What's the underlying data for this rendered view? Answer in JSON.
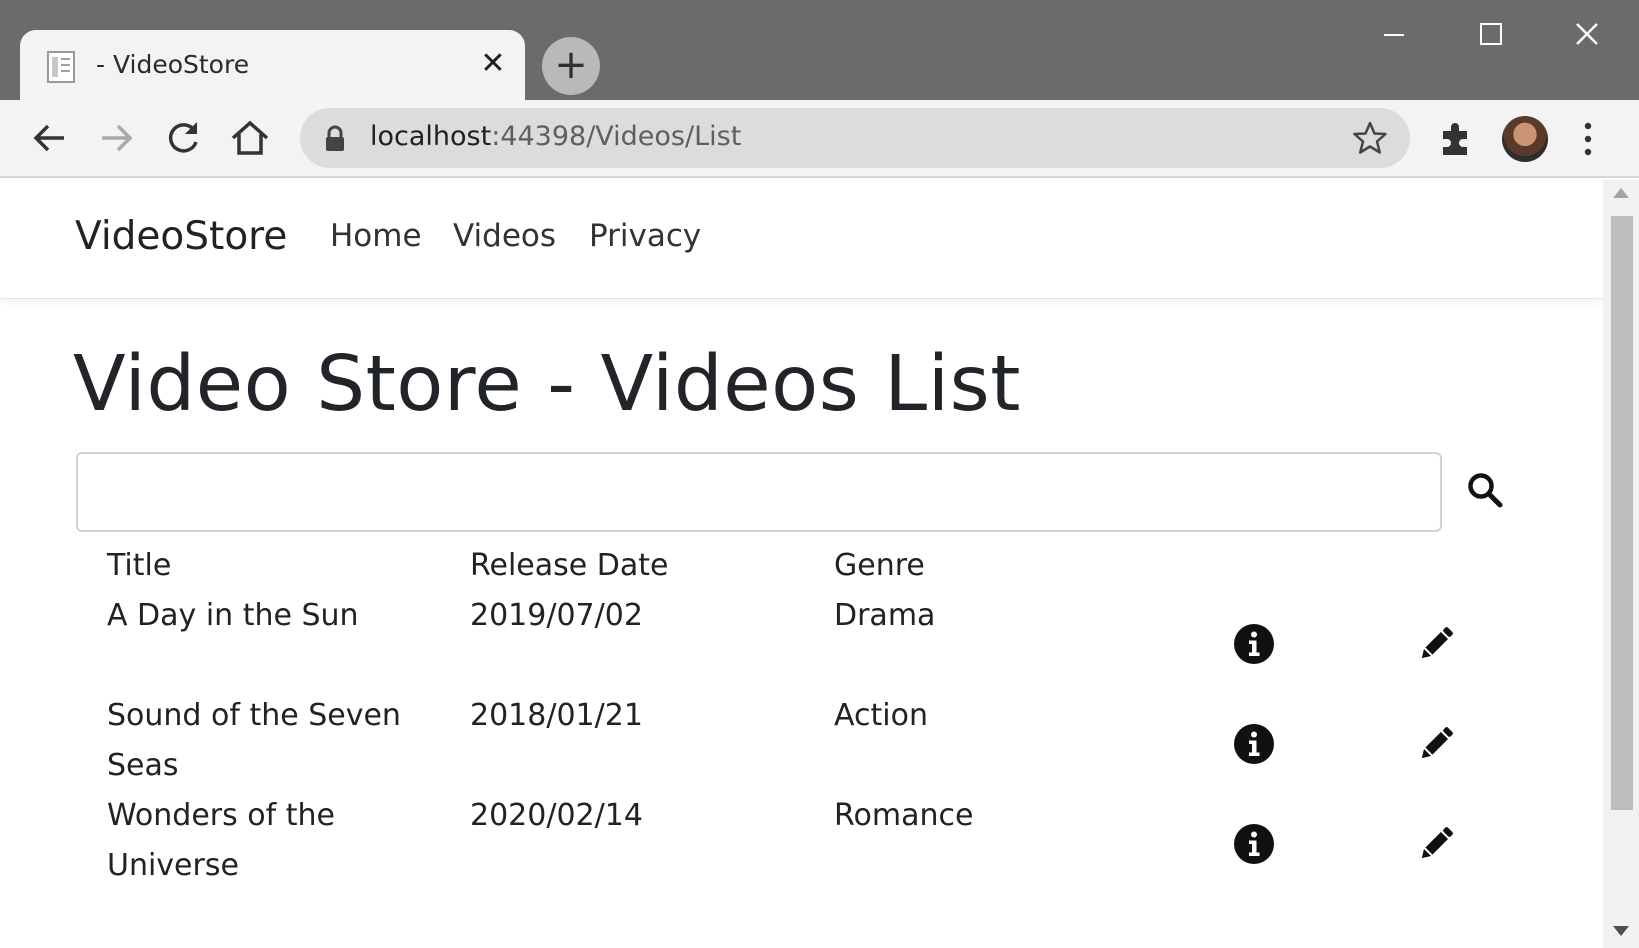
{
  "browser": {
    "tab_title": "- VideoStore",
    "tab_favicon": "page-icon",
    "new_tab_label": "+",
    "close_tab_label": "✕",
    "url_host": "localhost",
    "url_rest": ":44398/Videos/List",
    "icons": [
      "back-icon",
      "forward-icon",
      "reload-icon",
      "home-icon",
      "lock-icon",
      "star-icon",
      "extensions-icon",
      "menu-icon"
    ]
  },
  "navbar": {
    "brand": "VideoStore",
    "links": [
      {
        "label": "Home"
      },
      {
        "label": "Videos"
      },
      {
        "label": "Privacy"
      }
    ]
  },
  "page": {
    "heading": "Video Store - Videos List",
    "search_value": ""
  },
  "table": {
    "headers": [
      "Title",
      "Release Date",
      "Genre"
    ],
    "rows": [
      {
        "title": "A Day in the Sun",
        "release_date": "2019/07/02",
        "genre": "Drama"
      },
      {
        "title": "Sound of the Seven Seas",
        "release_date": "2018/01/21",
        "genre": "Action"
      },
      {
        "title": "Wonders of the Universe",
        "release_date": "2020/02/14",
        "genre": "Romance"
      }
    ],
    "row_actions": [
      "info-icon",
      "pencil-icon"
    ]
  },
  "colors": {
    "titlebar": "#6b6b6b",
    "toolbar": "#f3f3f3",
    "text": "#212529"
  }
}
